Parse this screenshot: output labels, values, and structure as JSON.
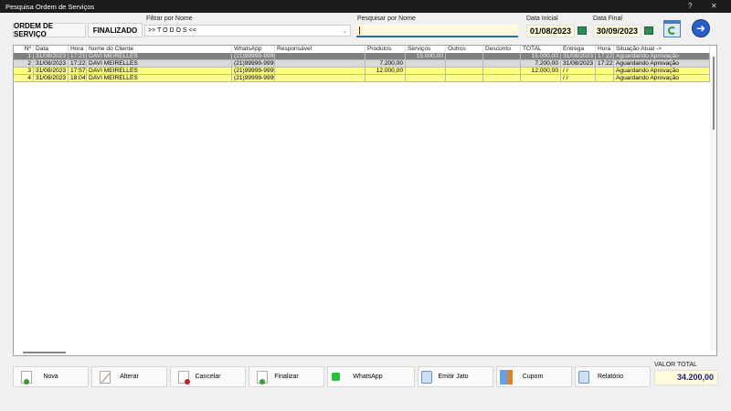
{
  "window": {
    "title": "Pesquisa Ordem de Serviços",
    "help": "?",
    "close": "✕"
  },
  "toolbar": {
    "tab_os": "ORDEM DE SERVIÇO",
    "tab_finalizado": "FINALIZADO",
    "filter_label": "Filtrar por Nome",
    "filter_value": ">> T O D O S <<",
    "search_label": "Pesquisar por Nome",
    "search_value": "",
    "date_start_label": "Data Inicial",
    "date_start": "01/08/2023",
    "date_end_label": "Data Final",
    "date_end": "30/09/2023"
  },
  "table": {
    "columns": [
      "Nº",
      "Data",
      "Hora",
      "Nome do Cliente",
      "WhatsApp",
      "Responsável",
      "Produtos",
      "Serviços",
      "Outros",
      "Desconto",
      "TOTAL",
      "Entrega",
      "Hora",
      "Situação Atual ->"
    ],
    "rows": [
      [
        "1",
        "31/08/2023",
        "17:21",
        "DAVI MEIRELLES",
        "(21)99999-9999",
        "",
        "",
        "15.000,00",
        "",
        "",
        "15.000,00",
        "31/08/2023",
        "17:22",
        "Aguardando Aprovação"
      ],
      [
        "2",
        "31/08/2023",
        "17:22",
        "DAVI MEIRELLES",
        "(21)99999-9999",
        "",
        "7.200,00",
        "",
        "",
        "",
        "7.200,00",
        "31/08/2023",
        "17:22",
        "Aguardando Aprovação"
      ],
      [
        "3",
        "31/08/2023",
        "17:57",
        "DAVI MEIRELLES",
        "(21)99999-9999",
        "",
        "12.000,00",
        "",
        "",
        "",
        "12.000,00",
        " / /",
        "",
        "Aguardando Aprovação"
      ],
      [
        "4",
        "31/08/2023",
        "18:04",
        "DAVI MEIRELLES",
        "(21)99999-9999",
        "",
        "",
        "",
        "",
        "",
        "",
        " / /",
        "",
        "Aguardando Aprovação"
      ]
    ]
  },
  "buttons": {
    "nova": "Nova",
    "alterar": "Alterar",
    "cancelar": "Cancelar",
    "finalizar": "Finalizar",
    "whatsapp": "WhatsApp",
    "emitir_jato": "Emitir Jato",
    "cupom": "Cupom",
    "relatorio": "Relatório"
  },
  "total": {
    "label": "VALOR TOTAL",
    "value": "34.200,00"
  },
  "colors": {
    "selected_row": "#808080",
    "gray_row": "#d9d9d9",
    "yellow_row": "#ffff80",
    "total_text": "#1a1a8c"
  }
}
